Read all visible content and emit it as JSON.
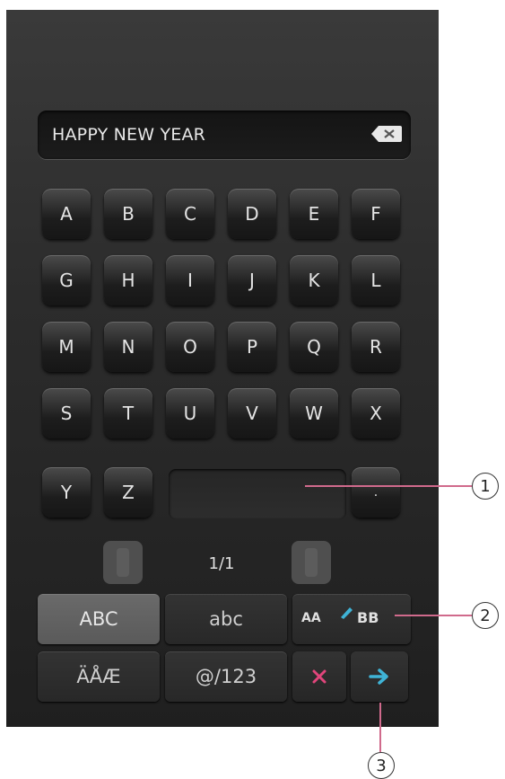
{
  "text_field": {
    "value": "HAPPY NEW YEAR"
  },
  "letters": [
    "A",
    "B",
    "C",
    "D",
    "E",
    "F",
    "G",
    "H",
    "I",
    "J",
    "K",
    "L",
    "M",
    "N",
    "O",
    "P",
    "Q",
    "R",
    "S",
    "T",
    "U",
    "V",
    "W",
    "X",
    "Y",
    "Z"
  ],
  "period_key": ".",
  "page": {
    "label": "1/1"
  },
  "modes": {
    "upper": "ABC",
    "lower": "abc",
    "accented": "ÄÅÆ",
    "symbols": "@/123",
    "case_small": "AA",
    "case_big": "BB"
  },
  "callouts": [
    "1",
    "2",
    "3"
  ],
  "colors": {
    "delete": "#e0457b",
    "enter": "#3fb3d6",
    "callout_line": "#d06a8c"
  },
  "icons": {
    "backspace": "backspace-icon",
    "delete": "close-icon",
    "enter": "arrow-right-icon",
    "case_toggle": "pencil-icon",
    "prev": "chevron-left-icon",
    "next": "chevron-right-icon"
  }
}
